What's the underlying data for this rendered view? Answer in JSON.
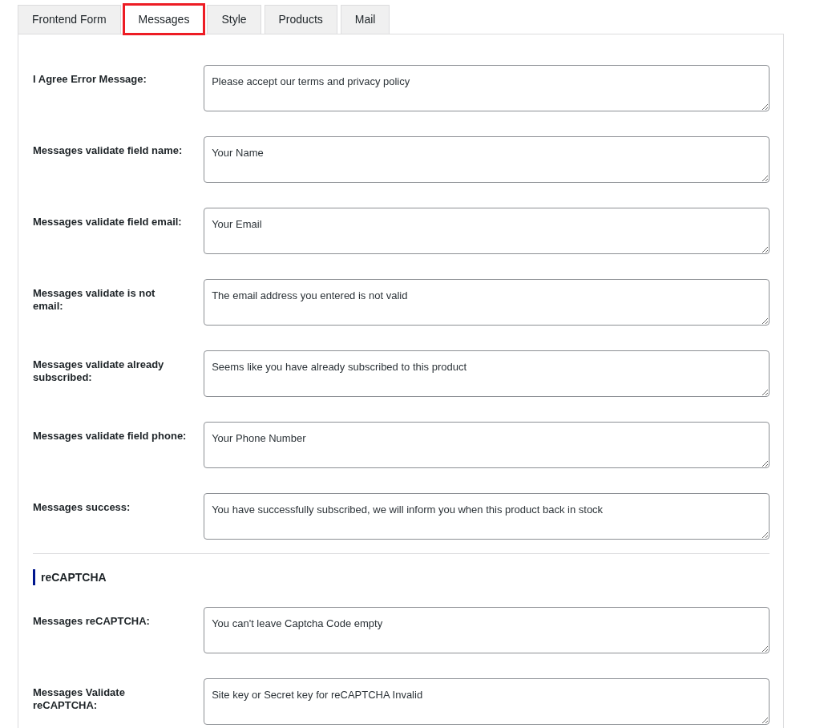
{
  "tabs": [
    {
      "label": "Frontend Form",
      "selected": false,
      "highlighted": false
    },
    {
      "label": "Messages",
      "selected": true,
      "highlighted": true
    },
    {
      "label": "Style",
      "selected": false,
      "highlighted": false
    },
    {
      "label": "Products",
      "selected": false,
      "highlighted": false
    },
    {
      "label": "Mail",
      "selected": false,
      "highlighted": false
    }
  ],
  "messages": [
    {
      "label": "I Agree Error Message:",
      "value": "Please accept our terms and privacy policy"
    },
    {
      "label": "Messages validate field name:",
      "value": "Your Name"
    },
    {
      "label": "Messages validate field email:",
      "value": "Your Email"
    },
    {
      "label": "Messages validate is not email:",
      "value": "The email address you entered is not valid"
    },
    {
      "label": "Messages validate already subscribed:",
      "value": "Seems like you have already subscribed to this product"
    },
    {
      "label": "Messages validate field phone:",
      "value": "Your Phone Number"
    },
    {
      "label": "Messages success:",
      "value": "You have successfully subscribed, we will inform you when this product back in stock"
    }
  ],
  "recaptcha": {
    "heading": "reCAPTCHA",
    "fields": [
      {
        "label": "Messages reCAPTCHA:",
        "value": "You can't leave Captcha Code empty"
      },
      {
        "label": "Messages Validate reCAPTCHA:",
        "value": "Site key or Secret key for reCAPTCHA Invalid"
      }
    ]
  }
}
